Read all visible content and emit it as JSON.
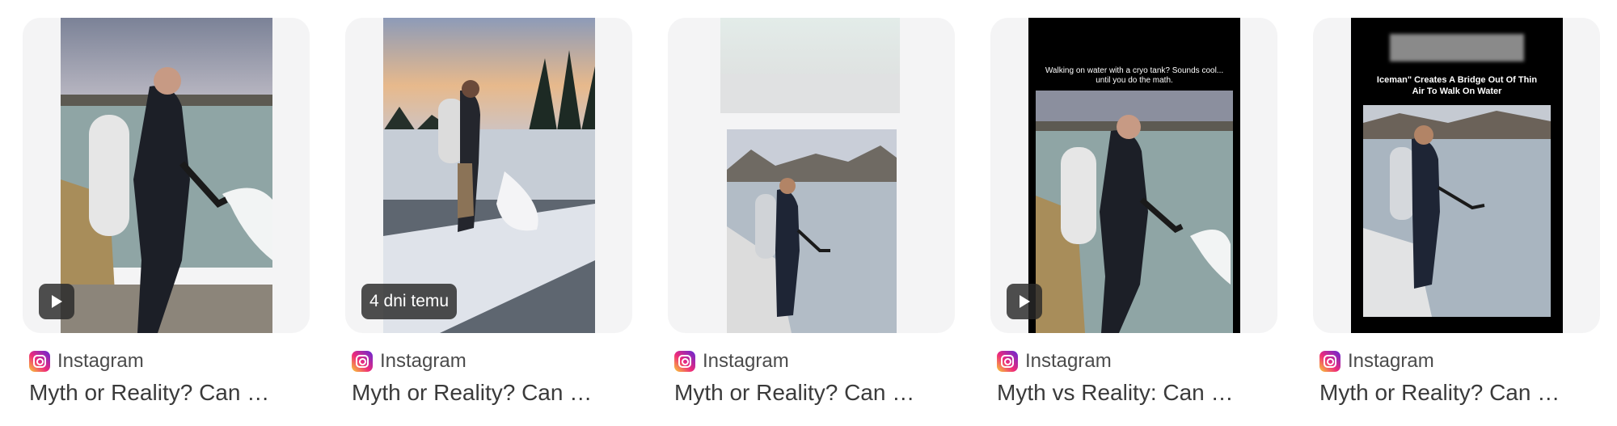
{
  "results": [
    {
      "source": "Instagram",
      "title": "Myth or Reality? Can …",
      "has_play": true,
      "badge": ""
    },
    {
      "source": "Instagram",
      "title": "Myth or Reality? Can …",
      "has_play": false,
      "badge": "4 dni temu"
    },
    {
      "source": "Instagram",
      "title": "Myth or Reality? Can …",
      "has_play": false,
      "badge": ""
    },
    {
      "source": "Instagram",
      "title": "Myth vs Reality: Can …",
      "has_play": true,
      "badge": "",
      "caption": "Walking on water with a cryo tank? Sounds cool... until you do the math."
    },
    {
      "source": "Instagram",
      "title": "Myth or Reality? Can …",
      "has_play": false,
      "badge": "",
      "caption": "Iceman\" Creates A Bridge Out Of Thin Air To Walk On Water"
    }
  ],
  "colors": {
    "card_bg": "#f4f4f5",
    "instagram_gradient": [
      "#f9ce34",
      "#ee2a7b",
      "#6228d7"
    ]
  }
}
